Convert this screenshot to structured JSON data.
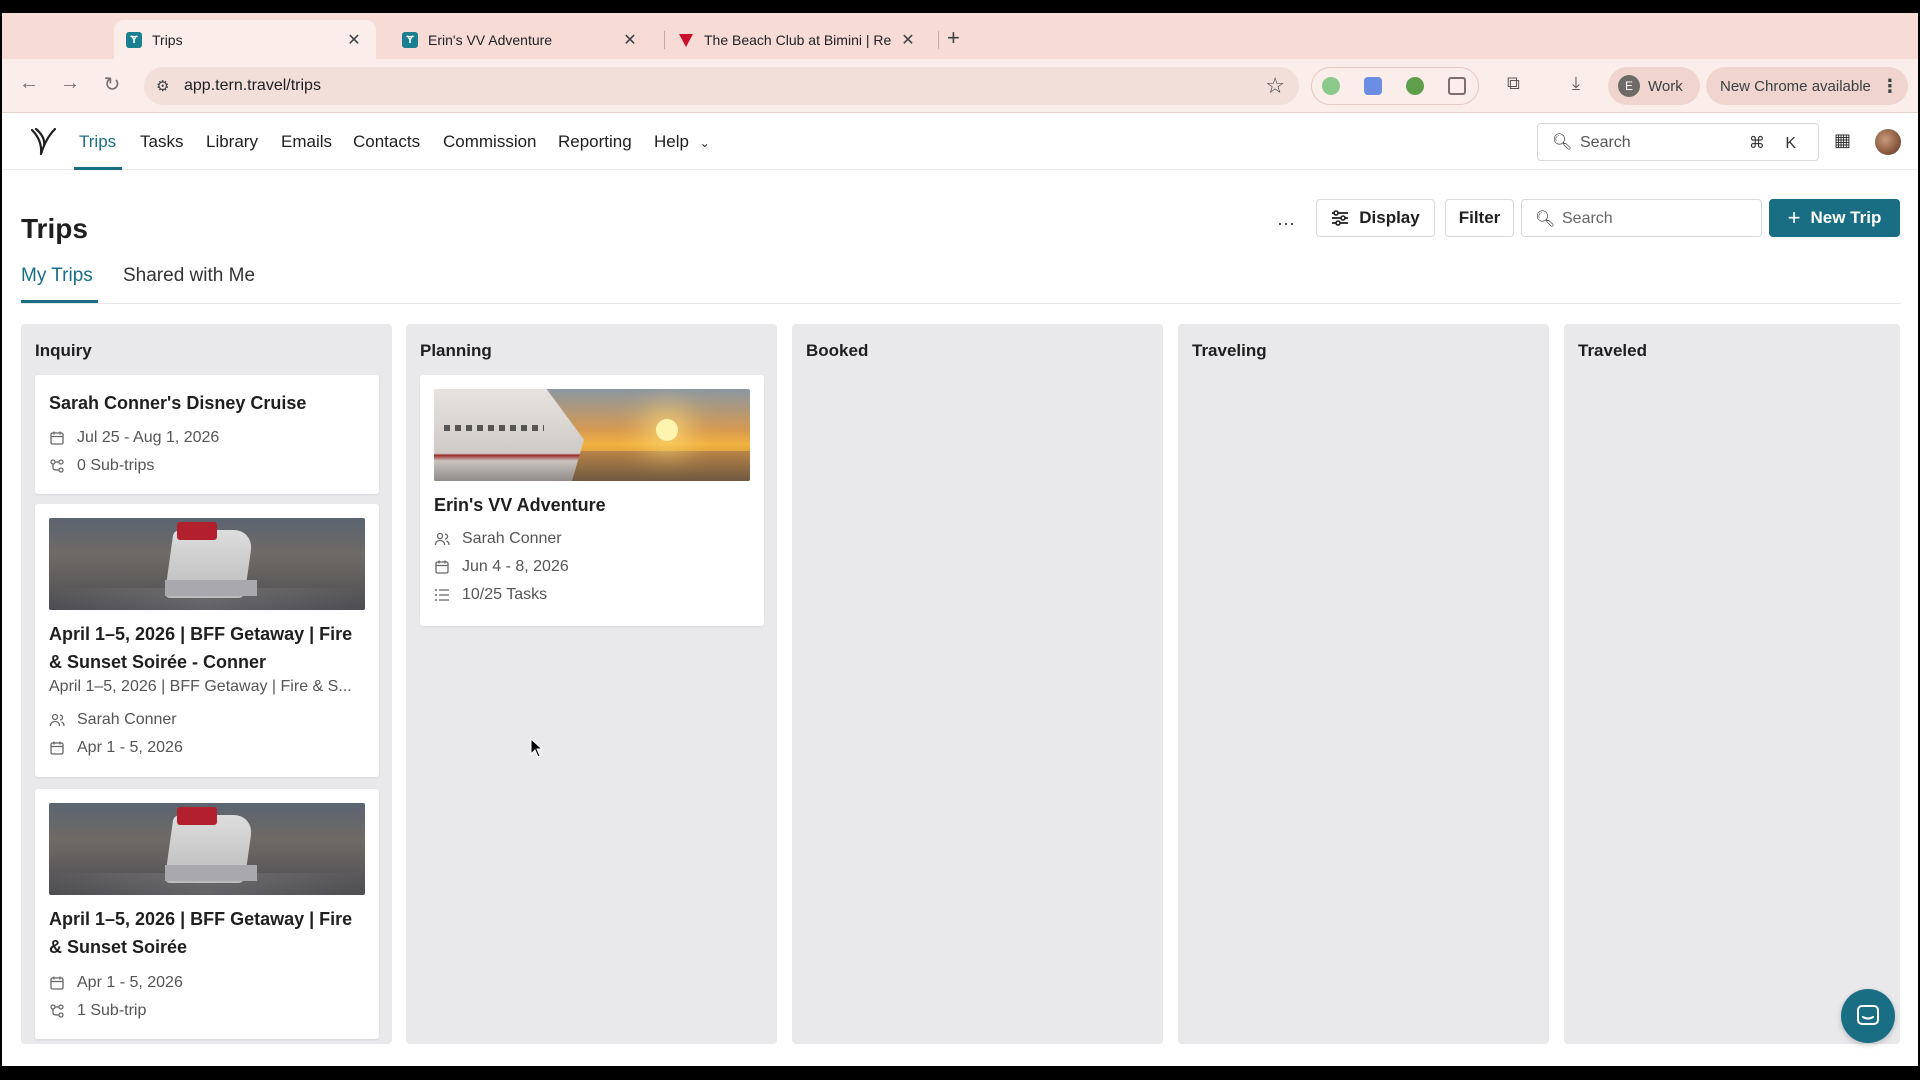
{
  "browser": {
    "tabs": [
      {
        "title": "Trips",
        "active": true
      },
      {
        "title": "Erin's VV Adventure",
        "active": false
      },
      {
        "title": "The Beach Club at Bimini | Re",
        "active": false
      }
    ],
    "url": "app.tern.travel/trips",
    "profile": {
      "initial": "E",
      "label": "Work"
    },
    "update_label": "New Chrome available"
  },
  "nav": {
    "items": [
      "Trips",
      "Tasks",
      "Library",
      "Emails",
      "Contacts",
      "Commission",
      "Reporting",
      "Help"
    ],
    "active": "Trips",
    "search_placeholder": "Search",
    "search_shortcut": "⌘ K"
  },
  "page": {
    "title": "Trips",
    "more_label": "···",
    "display_label": "Display",
    "filter_label": "Filter",
    "search_placeholder": "Search",
    "new_trip_label": "New Trip",
    "subtabs": [
      "My Trips",
      "Shared with Me"
    ],
    "active_subtab": "My Trips"
  },
  "board": {
    "columns": [
      {
        "title": "Inquiry",
        "cards": [
          {
            "title": "Sarah Conner's Disney Cruise",
            "dates": "Jul 25 - Aug 1, 2026",
            "subtrips": "0 Sub-trips"
          },
          {
            "title": "April 1–5, 2026 | BFF Getaway | Fire & Sunset Soirée - Conner",
            "description": "April 1–5, 2026 | BFF Getaway | Fire & S...",
            "traveler": "Sarah Conner",
            "dates": "Apr 1 - 5, 2026"
          },
          {
            "title": "April 1–5, 2026 | BFF Getaway | Fire & Sunset Soirée",
            "dates": "Apr 1 - 5, 2026",
            "subtrips": "1 Sub-trip"
          }
        ]
      },
      {
        "title": "Planning",
        "cards": [
          {
            "title": "Erin's VV Adventure",
            "traveler": "Sarah Conner",
            "dates": "Jun 4 - 8, 2026",
            "tasks": "10/25 Tasks"
          }
        ]
      },
      {
        "title": "Booked",
        "cards": []
      },
      {
        "title": "Traveling",
        "cards": []
      },
      {
        "title": "Traveled",
        "cards": []
      }
    ]
  },
  "colors": {
    "accent": "#1a6e84",
    "column_bg": "#e9e9ec",
    "tab_strip": "#f7dcd6"
  }
}
